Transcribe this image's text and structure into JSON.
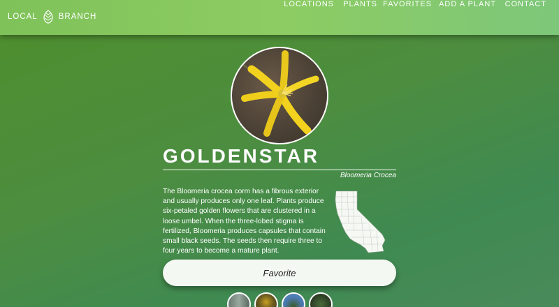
{
  "nav": {
    "brand_left": "LOCAL",
    "brand_right": "BRANCH",
    "logo_icon": "pinecone-icon",
    "links": [
      "LOCATIONS",
      "PLANTS",
      "FAVORITES",
      "ADD A PLANT",
      "CONTACT"
    ]
  },
  "plant": {
    "common_name": "GOLDENSTAR",
    "scientific_name": "Bloomeria Crocea",
    "description": "The Bloomeria crocea corm has a fibrous exterior and usually produces only one leaf. Plants produce six-petaled golden flowers that are clustered in a loose umbel. When the three-lobed stigma is fertilized, Bloomeria produces capsules that contain small black seeds. The seeds then require three to four years to become a mature plant.",
    "map_icon": "california-map-icon"
  },
  "favorite_button": "Favorite",
  "colors": {
    "nav_bg": "#8dcc62",
    "page_bg": "#4c8d40",
    "flower": "#f2d21e",
    "button_bg": "#f4f8f2"
  }
}
